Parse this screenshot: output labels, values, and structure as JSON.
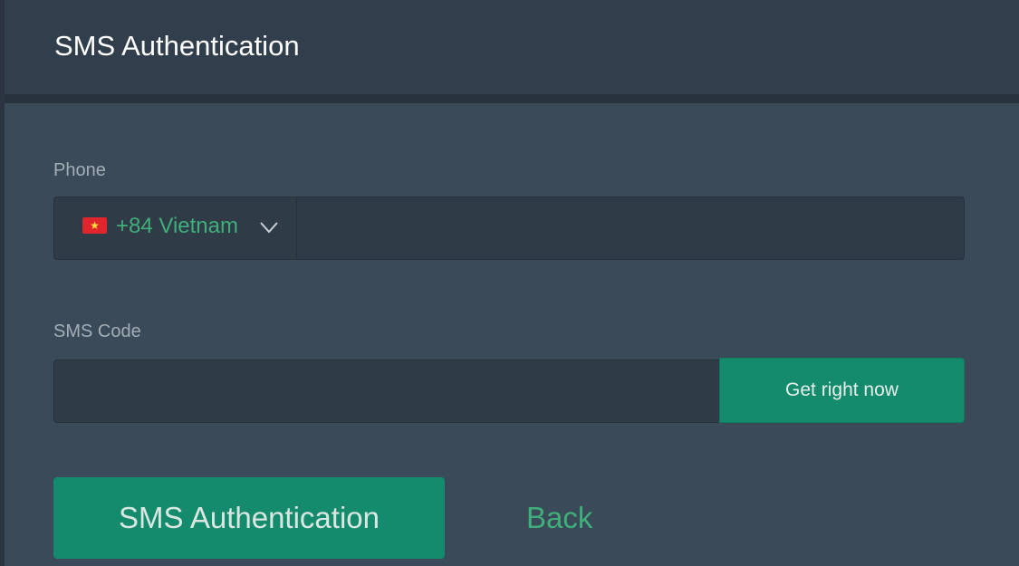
{
  "header": {
    "title": "SMS Authentication"
  },
  "form": {
    "phone_label": "Phone",
    "country": {
      "code": "+84",
      "name": "Vietnam",
      "display": "+84 Vietnam",
      "flag_icon": "vietnam-flag-icon"
    },
    "phone_value": "",
    "sms_label": "SMS Code",
    "sms_value": "",
    "get_code_label": "Get right now",
    "submit_label": "SMS Authentication",
    "back_label": "Back"
  },
  "colors": {
    "background": "#3a4a58",
    "header": "#313e4b",
    "accent": "#148b6c",
    "link": "#3fae7a"
  }
}
